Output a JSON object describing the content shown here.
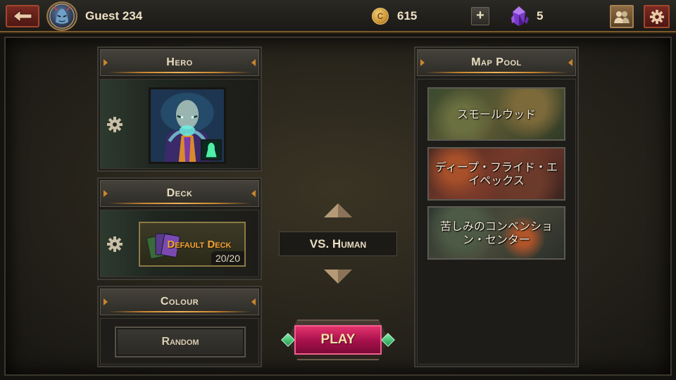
{
  "topbar": {
    "username": "Guest 234",
    "coin_symbol": "C",
    "coins": "615",
    "plus_label": "+",
    "gems": "5",
    "icons": {
      "back": "back-arrow-icon",
      "avatar": "player-avatar",
      "coin": "coin-icon",
      "gem": "crystal-gem-icon",
      "friends": "friends-icon",
      "settings": "gear-icon"
    }
  },
  "hero": {
    "title": "Hero"
  },
  "deck": {
    "title": "Deck",
    "name": "Default Deck",
    "count": "20/20"
  },
  "colour": {
    "title": "Colour",
    "value": "Random"
  },
  "center": {
    "mode": "VS. Human",
    "play": "PLAY"
  },
  "map_pool": {
    "title": "Map Pool",
    "maps": [
      {
        "name": "スモールウッド"
      },
      {
        "name": "ディープ・フライド・エイペックス"
      },
      {
        "name": "苦しみのコンベンション・センター"
      }
    ]
  },
  "colors": {
    "accent_gold": "#c9852e",
    "play_pink": "#e3336e",
    "deck_orange": "#f0a43a"
  }
}
